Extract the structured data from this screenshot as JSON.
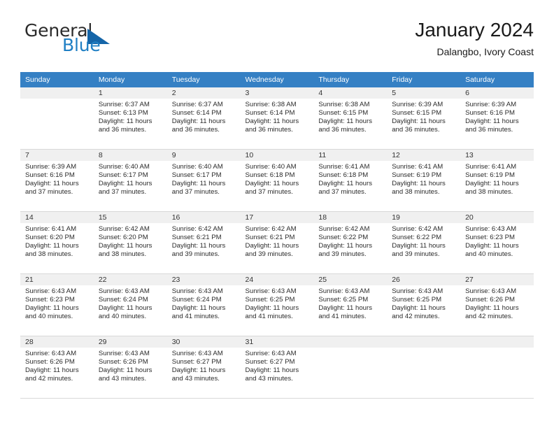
{
  "brand": {
    "name_top": "General",
    "name_bottom": "Blue",
    "triangle_color": "#1565a8",
    "blue_color": "#1f7fc4"
  },
  "header": {
    "title": "January 2024",
    "subtitle": "Dalangbo, Ivory Coast",
    "header_bg": "#3580c4",
    "header_text_color": "#ffffff"
  },
  "weekdays": [
    "Sunday",
    "Monday",
    "Tuesday",
    "Wednesday",
    "Thursday",
    "Friday",
    "Saturday"
  ],
  "labels": {
    "sunrise_prefix": "Sunrise:",
    "sunset_prefix": "Sunset:",
    "daylight_prefix": "Daylight:"
  },
  "weeks": [
    [
      {
        "day": "",
        "sunrise": "",
        "sunset": "",
        "daylight_line1": "",
        "daylight_line2": ""
      },
      {
        "day": "1",
        "sunrise": "Sunrise: 6:37 AM",
        "sunset": "Sunset: 6:13 PM",
        "daylight_line1": "Daylight: 11 hours",
        "daylight_line2": "and 36 minutes."
      },
      {
        "day": "2",
        "sunrise": "Sunrise: 6:37 AM",
        "sunset": "Sunset: 6:14 PM",
        "daylight_line1": "Daylight: 11 hours",
        "daylight_line2": "and 36 minutes."
      },
      {
        "day": "3",
        "sunrise": "Sunrise: 6:38 AM",
        "sunset": "Sunset: 6:14 PM",
        "daylight_line1": "Daylight: 11 hours",
        "daylight_line2": "and 36 minutes."
      },
      {
        "day": "4",
        "sunrise": "Sunrise: 6:38 AM",
        "sunset": "Sunset: 6:15 PM",
        "daylight_line1": "Daylight: 11 hours",
        "daylight_line2": "and 36 minutes."
      },
      {
        "day": "5",
        "sunrise": "Sunrise: 6:39 AM",
        "sunset": "Sunset: 6:15 PM",
        "daylight_line1": "Daylight: 11 hours",
        "daylight_line2": "and 36 minutes."
      },
      {
        "day": "6",
        "sunrise": "Sunrise: 6:39 AM",
        "sunset": "Sunset: 6:16 PM",
        "daylight_line1": "Daylight: 11 hours",
        "daylight_line2": "and 36 minutes."
      }
    ],
    [
      {
        "day": "7",
        "sunrise": "Sunrise: 6:39 AM",
        "sunset": "Sunset: 6:16 PM",
        "daylight_line1": "Daylight: 11 hours",
        "daylight_line2": "and 37 minutes."
      },
      {
        "day": "8",
        "sunrise": "Sunrise: 6:40 AM",
        "sunset": "Sunset: 6:17 PM",
        "daylight_line1": "Daylight: 11 hours",
        "daylight_line2": "and 37 minutes."
      },
      {
        "day": "9",
        "sunrise": "Sunrise: 6:40 AM",
        "sunset": "Sunset: 6:17 PM",
        "daylight_line1": "Daylight: 11 hours",
        "daylight_line2": "and 37 minutes."
      },
      {
        "day": "10",
        "sunrise": "Sunrise: 6:40 AM",
        "sunset": "Sunset: 6:18 PM",
        "daylight_line1": "Daylight: 11 hours",
        "daylight_line2": "and 37 minutes."
      },
      {
        "day": "11",
        "sunrise": "Sunrise: 6:41 AM",
        "sunset": "Sunset: 6:18 PM",
        "daylight_line1": "Daylight: 11 hours",
        "daylight_line2": "and 37 minutes."
      },
      {
        "day": "12",
        "sunrise": "Sunrise: 6:41 AM",
        "sunset": "Sunset: 6:19 PM",
        "daylight_line1": "Daylight: 11 hours",
        "daylight_line2": "and 38 minutes."
      },
      {
        "day": "13",
        "sunrise": "Sunrise: 6:41 AM",
        "sunset": "Sunset: 6:19 PM",
        "daylight_line1": "Daylight: 11 hours",
        "daylight_line2": "and 38 minutes."
      }
    ],
    [
      {
        "day": "14",
        "sunrise": "Sunrise: 6:41 AM",
        "sunset": "Sunset: 6:20 PM",
        "daylight_line1": "Daylight: 11 hours",
        "daylight_line2": "and 38 minutes."
      },
      {
        "day": "15",
        "sunrise": "Sunrise: 6:42 AM",
        "sunset": "Sunset: 6:20 PM",
        "daylight_line1": "Daylight: 11 hours",
        "daylight_line2": "and 38 minutes."
      },
      {
        "day": "16",
        "sunrise": "Sunrise: 6:42 AM",
        "sunset": "Sunset: 6:21 PM",
        "daylight_line1": "Daylight: 11 hours",
        "daylight_line2": "and 39 minutes."
      },
      {
        "day": "17",
        "sunrise": "Sunrise: 6:42 AM",
        "sunset": "Sunset: 6:21 PM",
        "daylight_line1": "Daylight: 11 hours",
        "daylight_line2": "and 39 minutes."
      },
      {
        "day": "18",
        "sunrise": "Sunrise: 6:42 AM",
        "sunset": "Sunset: 6:22 PM",
        "daylight_line1": "Daylight: 11 hours",
        "daylight_line2": "and 39 minutes."
      },
      {
        "day": "19",
        "sunrise": "Sunrise: 6:42 AM",
        "sunset": "Sunset: 6:22 PM",
        "daylight_line1": "Daylight: 11 hours",
        "daylight_line2": "and 39 minutes."
      },
      {
        "day": "20",
        "sunrise": "Sunrise: 6:43 AM",
        "sunset": "Sunset: 6:23 PM",
        "daylight_line1": "Daylight: 11 hours",
        "daylight_line2": "and 40 minutes."
      }
    ],
    [
      {
        "day": "21",
        "sunrise": "Sunrise: 6:43 AM",
        "sunset": "Sunset: 6:23 PM",
        "daylight_line1": "Daylight: 11 hours",
        "daylight_line2": "and 40 minutes."
      },
      {
        "day": "22",
        "sunrise": "Sunrise: 6:43 AM",
        "sunset": "Sunset: 6:24 PM",
        "daylight_line1": "Daylight: 11 hours",
        "daylight_line2": "and 40 minutes."
      },
      {
        "day": "23",
        "sunrise": "Sunrise: 6:43 AM",
        "sunset": "Sunset: 6:24 PM",
        "daylight_line1": "Daylight: 11 hours",
        "daylight_line2": "and 41 minutes."
      },
      {
        "day": "24",
        "sunrise": "Sunrise: 6:43 AM",
        "sunset": "Sunset: 6:25 PM",
        "daylight_line1": "Daylight: 11 hours",
        "daylight_line2": "and 41 minutes."
      },
      {
        "day": "25",
        "sunrise": "Sunrise: 6:43 AM",
        "sunset": "Sunset: 6:25 PM",
        "daylight_line1": "Daylight: 11 hours",
        "daylight_line2": "and 41 minutes."
      },
      {
        "day": "26",
        "sunrise": "Sunrise: 6:43 AM",
        "sunset": "Sunset: 6:25 PM",
        "daylight_line1": "Daylight: 11 hours",
        "daylight_line2": "and 42 minutes."
      },
      {
        "day": "27",
        "sunrise": "Sunrise: 6:43 AM",
        "sunset": "Sunset: 6:26 PM",
        "daylight_line1": "Daylight: 11 hours",
        "daylight_line2": "and 42 minutes."
      }
    ],
    [
      {
        "day": "28",
        "sunrise": "Sunrise: 6:43 AM",
        "sunset": "Sunset: 6:26 PM",
        "daylight_line1": "Daylight: 11 hours",
        "daylight_line2": "and 42 minutes."
      },
      {
        "day": "29",
        "sunrise": "Sunrise: 6:43 AM",
        "sunset": "Sunset: 6:26 PM",
        "daylight_line1": "Daylight: 11 hours",
        "daylight_line2": "and 43 minutes."
      },
      {
        "day": "30",
        "sunrise": "Sunrise: 6:43 AM",
        "sunset": "Sunset: 6:27 PM",
        "daylight_line1": "Daylight: 11 hours",
        "daylight_line2": "and 43 minutes."
      },
      {
        "day": "31",
        "sunrise": "Sunrise: 6:43 AM",
        "sunset": "Sunset: 6:27 PM",
        "daylight_line1": "Daylight: 11 hours",
        "daylight_line2": "and 43 minutes."
      },
      {
        "day": "",
        "sunrise": "",
        "sunset": "",
        "daylight_line1": "",
        "daylight_line2": ""
      },
      {
        "day": "",
        "sunrise": "",
        "sunset": "",
        "daylight_line1": "",
        "daylight_line2": ""
      },
      {
        "day": "",
        "sunrise": "",
        "sunset": "",
        "daylight_line1": "",
        "daylight_line2": ""
      }
    ]
  ]
}
